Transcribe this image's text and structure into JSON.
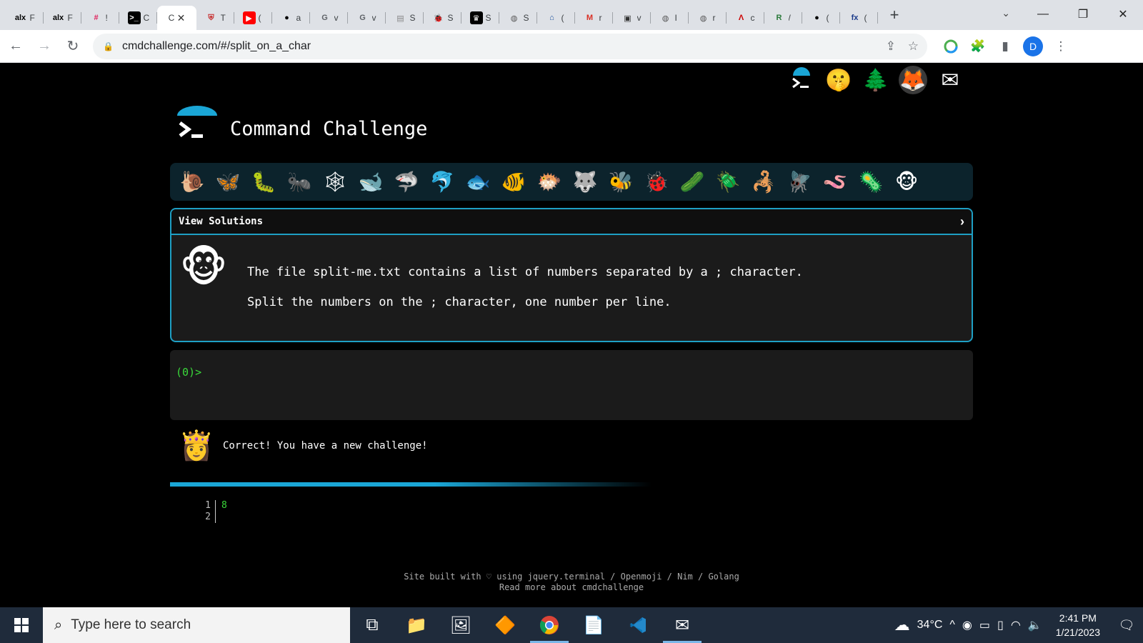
{
  "browser": {
    "tabs": [
      {
        "icon": "alx",
        "title": "F"
      },
      {
        "icon": "alx",
        "title": "F"
      },
      {
        "icon": "slack",
        "title": "!"
      },
      {
        "icon": "terminal",
        "title": "C"
      },
      {
        "icon": "active",
        "title": "C"
      },
      {
        "icon": "shield",
        "title": "T"
      },
      {
        "icon": "youtube",
        "title": "("
      },
      {
        "icon": "github",
        "title": "a"
      },
      {
        "icon": "google",
        "title": "v"
      },
      {
        "icon": "google",
        "title": "v"
      },
      {
        "icon": "doc",
        "title": "S"
      },
      {
        "icon": "bug",
        "title": "S"
      },
      {
        "icon": "crown",
        "title": "S"
      },
      {
        "icon": "globe",
        "title": "S"
      },
      {
        "icon": "bank",
        "title": "("
      },
      {
        "icon": "gmail",
        "title": "r"
      },
      {
        "icon": "box",
        "title": "v"
      },
      {
        "icon": "globe",
        "title": "I"
      },
      {
        "icon": "globe",
        "title": "r"
      },
      {
        "icon": "a",
        "title": "c"
      },
      {
        "icon": "R",
        "title": "/"
      },
      {
        "icon": "github",
        "title": "("
      },
      {
        "icon": "fx",
        "title": "("
      }
    ],
    "url": "cmdchallenge.com/#/split_on_a_char",
    "profile_initial": "D"
  },
  "page": {
    "site_title": "Command Challenge",
    "view_solutions": "View Solutions",
    "challenge_line1": "The file split-me.txt contains a list of numbers separated by a ; character.",
    "challenge_line2": "Split the numbers on the ; character, one number per line.",
    "prompt": "(0)>",
    "feedback": "Correct! You have a new challenge!",
    "progress_fraction": 0.6,
    "code_line_numbers": [
      "1",
      "2"
    ],
    "code_lines": [
      "8",
      ""
    ],
    "footer_line1": "Site built with ♡ using jquery.terminal / Openmoji / Nim / Golang",
    "footer_line2": "Read more about cmdchallenge"
  },
  "taskbar": {
    "search_placeholder": "Type here to search",
    "weather": "34°C",
    "time": "2:41 PM",
    "date": "1/21/2023"
  },
  "colors": {
    "accent": "#1e9fc4",
    "terminal_green": "#3ad93a",
    "animal_bar": "#0c232c"
  }
}
